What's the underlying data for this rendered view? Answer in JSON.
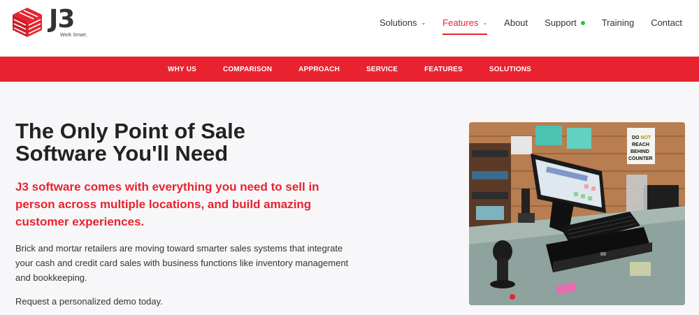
{
  "brand": {
    "name": "J3",
    "tagline": "Work Smart.",
    "accent": "#e8232f"
  },
  "nav": {
    "items": [
      {
        "label": "Solutions",
        "has_dropdown": true,
        "active": false
      },
      {
        "label": "Features",
        "has_dropdown": true,
        "active": true
      },
      {
        "label": "About",
        "has_dropdown": false,
        "active": false
      },
      {
        "label": "Support",
        "has_dropdown": false,
        "active": false,
        "status": "online"
      },
      {
        "label": "Training",
        "has_dropdown": false,
        "active": false
      },
      {
        "label": "Contact",
        "has_dropdown": false,
        "active": false
      }
    ]
  },
  "subnav": {
    "items": [
      "WHY US",
      "COMPARISON",
      "APPROACH",
      "SERVICE",
      "FEATURES",
      "SOLUTIONS"
    ]
  },
  "hero": {
    "title_line1": "The Only Point of Sale",
    "title_line2": "Software You'll Need",
    "subtitle": "J3 software comes with everything you need to sell in person across multiple locations, and build amazing customer experiences.",
    "body": "Brick and mortar retailers are moving toward smarter sales systems that integrate your cash and credit card sales with business functions like inventory management and bookkeeping.",
    "cta": "Request a personalized demo today."
  },
  "photo": {
    "sign_line1": "DO",
    "sign_line1_highlight": "NOT",
    "sign_line2": "REACH",
    "sign_line3": "BEHIND",
    "sign_line4": "COUNTER"
  }
}
